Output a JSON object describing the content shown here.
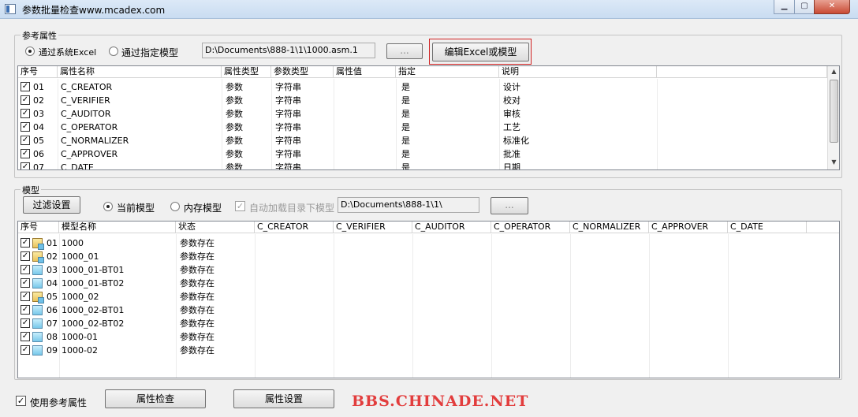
{
  "window": {
    "title": "参数批量检查www.mcadex.com",
    "controls": [
      "minimize",
      "maximize",
      "close"
    ]
  },
  "ref_group": {
    "label": "参考属性",
    "radio_excel": "通过系统Excel",
    "radio_model": "通过指定模型",
    "path": "D:\\Documents\\888-1\\1\\1000.asm.1",
    "browse": "...",
    "edit_button": "编辑Excel或模型",
    "columns": [
      "序号",
      "属性名称",
      "属性类型",
      "参数类型",
      "属性值",
      "指定",
      "说明"
    ],
    "rows": [
      {
        "no": "01",
        "name": "C_CREATOR",
        "ptype": "参数",
        "vtype": "字符串",
        "value": "",
        "assign": "是",
        "desc": "设计"
      },
      {
        "no": "02",
        "name": "C_VERIFIER",
        "ptype": "参数",
        "vtype": "字符串",
        "value": "",
        "assign": "是",
        "desc": "校对"
      },
      {
        "no": "03",
        "name": "C_AUDITOR",
        "ptype": "参数",
        "vtype": "字符串",
        "value": "",
        "assign": "是",
        "desc": "审核"
      },
      {
        "no": "04",
        "name": "C_OPERATOR",
        "ptype": "参数",
        "vtype": "字符串",
        "value": "",
        "assign": "是",
        "desc": "工艺"
      },
      {
        "no": "05",
        "name": "C_NORMALIZER",
        "ptype": "参数",
        "vtype": "字符串",
        "value": "",
        "assign": "是",
        "desc": "标准化"
      },
      {
        "no": "06",
        "name": "C_APPROVER",
        "ptype": "参数",
        "vtype": "字符串",
        "value": "",
        "assign": "是",
        "desc": "批准"
      },
      {
        "no": "07",
        "name": "C_DATE",
        "ptype": "参数",
        "vtype": "字符串",
        "value": "",
        "assign": "是",
        "desc": "日期"
      }
    ]
  },
  "model_group": {
    "label": "模型",
    "filter_button": "过滤设置",
    "radio_current": "当前模型",
    "radio_memory": "内存模型",
    "auto_load": "自动加载目录下模型",
    "path": "D:\\Documents\\888-1\\1\\",
    "browse": "...",
    "columns": [
      "序号",
      "模型名称",
      "状态",
      "C_CREATOR",
      "C_VERIFIER",
      "C_AUDITOR",
      "C_OPERATOR",
      "C_NORMALIZER",
      "C_APPROVER",
      "C_DATE"
    ],
    "rows": [
      {
        "no": "01",
        "name": "1000",
        "status": "参数存在",
        "kind": "assembly"
      },
      {
        "no": "02",
        "name": "1000_01",
        "status": "参数存在",
        "kind": "assembly"
      },
      {
        "no": "03",
        "name": "1000_01-BT01",
        "status": "参数存在",
        "kind": "part"
      },
      {
        "no": "04",
        "name": "1000_01-BT02",
        "status": "参数存在",
        "kind": "part"
      },
      {
        "no": "05",
        "name": "1000_02",
        "status": "参数存在",
        "kind": "assembly"
      },
      {
        "no": "06",
        "name": "1000_02-BT01",
        "status": "参数存在",
        "kind": "part"
      },
      {
        "no": "07",
        "name": "1000_02-BT02",
        "status": "参数存在",
        "kind": "part"
      },
      {
        "no": "08",
        "name": "1000-01",
        "status": "参数存在",
        "kind": "part"
      },
      {
        "no": "09",
        "name": "1000-02",
        "status": "参数存在",
        "kind": "part"
      }
    ]
  },
  "footer": {
    "use_ref": "使用参考属性",
    "check_button": "属性检查",
    "settings_button": "属性设置",
    "watermark": "BBS.CHINADE.NET"
  },
  "colors": {
    "highlight": "#d02020",
    "watermark": "#e23d3d"
  }
}
